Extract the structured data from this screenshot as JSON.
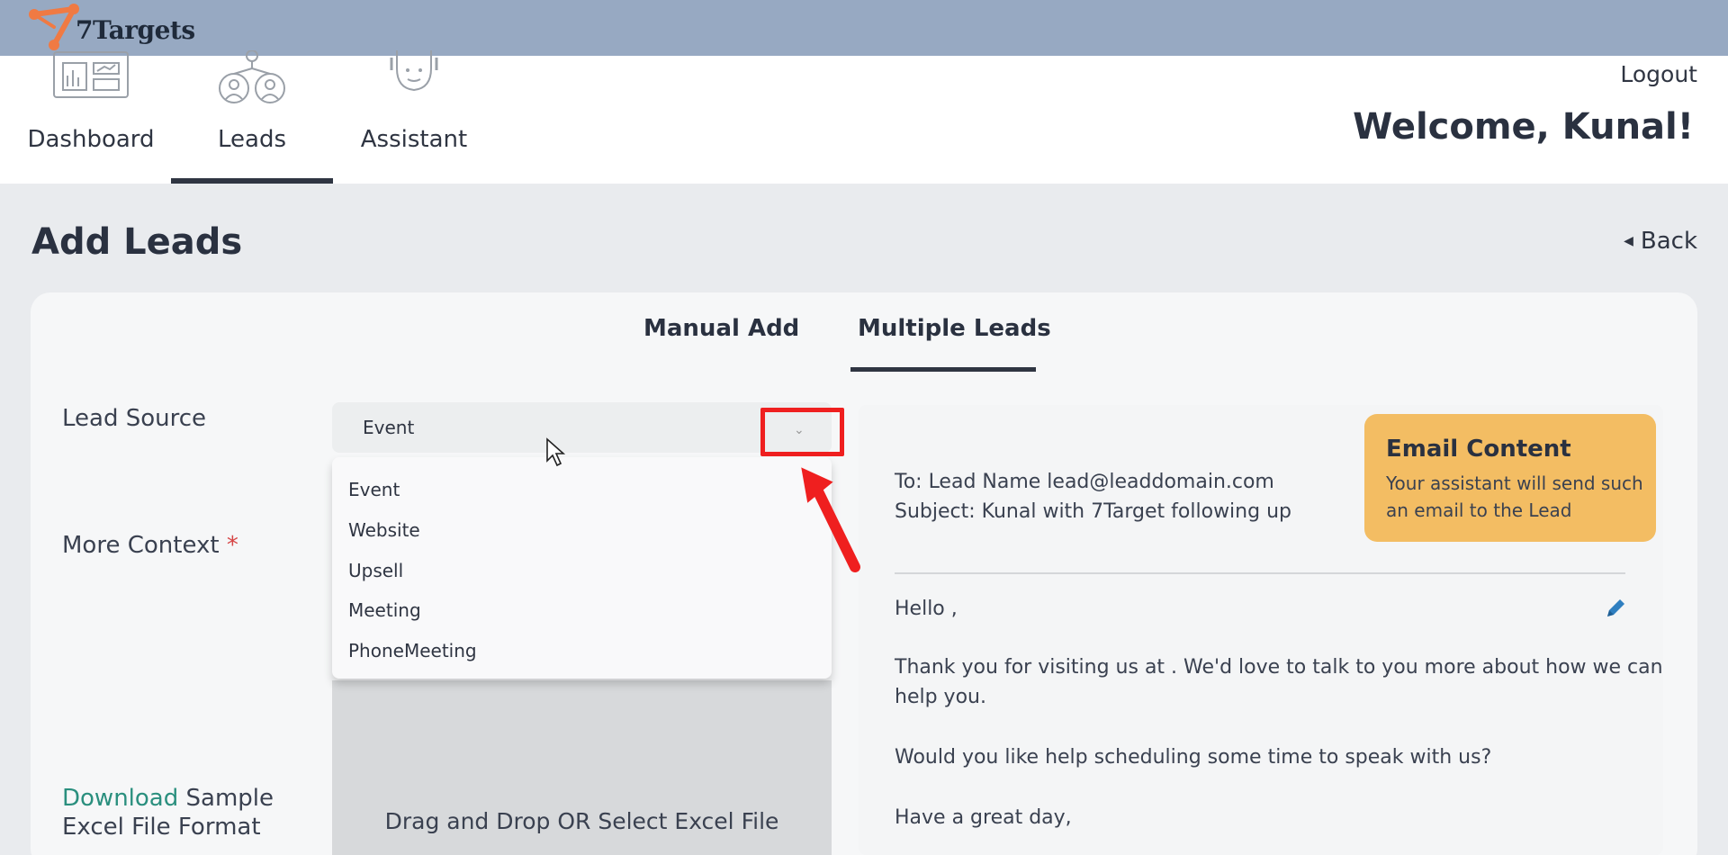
{
  "app": {
    "logo_text": "7Targets"
  },
  "nav": {
    "items": [
      {
        "label": "Dashboard",
        "icon": "dashboard-icon"
      },
      {
        "label": "Leads",
        "icon": "leads-icon"
      },
      {
        "label": "Assistant",
        "icon": "assistant-icon"
      }
    ],
    "active": "Leads"
  },
  "header": {
    "logout": "Logout",
    "welcome": "Welcome, Kunal!"
  },
  "page": {
    "title": "Add Leads",
    "back": "Back"
  },
  "tabs": [
    {
      "label": "Manual Add"
    },
    {
      "label": "Multiple Leads"
    }
  ],
  "active_tab": "Multiple Leads",
  "form": {
    "lead_source_label": "Lead Source",
    "lead_source_value": "Event",
    "lead_source_options": [
      "Event",
      "Website",
      "Upsell",
      "Meeting",
      "PhoneMeeting"
    ],
    "more_context_label": "More Context",
    "required_mark": "*",
    "download_link": "Download",
    "download_rest_1": " Sample",
    "download_rest_2": "Excel File Format",
    "drop_zone_text": "Drag and Drop OR Select Excel File"
  },
  "email": {
    "badge_title": "Email Content",
    "badge_desc": "Your assistant will send such an email to the Lead",
    "to": "To: Lead Name lead@leaddomain.com",
    "subject": "Subject: Kunal with 7Target following up",
    "greeting": "Hello ,",
    "body_1a": "Thank you for visiting us at . We'd love to talk to you more about how we can",
    "body_1b": "help you.",
    "body_2": "Would you like help scheduling some time to speak with us?",
    "sign_off": "Have a great day,"
  },
  "colors": {
    "topbar": "#97a9c2",
    "accent_orange": "#f07a43",
    "badge": "#f3bd63",
    "highlight_red": "#ef1f1f",
    "link": "#2a8f7e"
  }
}
